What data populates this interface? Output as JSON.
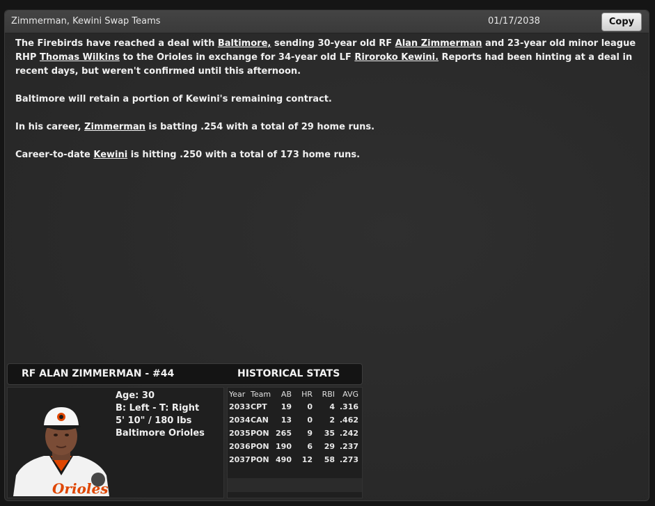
{
  "news": {
    "headline": "Zimmerman, Kewini Swap Teams",
    "date": "01/17/2038",
    "copy_label": "Copy",
    "p1": {
      "t1": "The Firebirds have reached a deal with ",
      "link_team": "Baltimore,",
      "t2": " sending 30-year old RF ",
      "link_player1": "Alan Zimmerman",
      "t3": " and 23-year old minor league RHP ",
      "link_player2": "Thomas Wilkins",
      "t4": " to the Orioles in exchange for 34-year old LF ",
      "link_player3": "Riroroko Kewini.",
      "t5": " Reports had been hinting at a deal in recent days, but weren't confirmed until this afternoon."
    },
    "p2": "Baltimore will retain a portion of Kewini's remaining contract.",
    "p3": {
      "t1": "In his career, ",
      "link": "Zimmerman",
      "t2": " is batting .254 with a total of 29 home runs."
    },
    "p4": {
      "t1": "Career-to-date ",
      "link": "Kewini",
      "t2": " is hitting .250 with a total of 173 home runs."
    }
  },
  "player": {
    "title": "RF ALAN ZIMMERMAN - #44",
    "age": "Age: 30",
    "bats_throws": "B: Left - T: Right",
    "size": "5' 10\" / 180 lbs",
    "team": "Baltimore Orioles",
    "jersey_text": "Orioles",
    "portrait_icon": "player-portrait-icon"
  },
  "stats": {
    "title": "HISTORICAL STATS",
    "headers": [
      "Year",
      "Team",
      "AB",
      "HR",
      "RBI",
      "AVG"
    ],
    "rows": [
      [
        "2033",
        "CPT",
        "19",
        "0",
        "4",
        ".316"
      ],
      [
        "2034",
        "CAN",
        "13",
        "0",
        "2",
        ".462"
      ],
      [
        "2035",
        "PON",
        "265",
        "9",
        "35",
        ".242"
      ],
      [
        "2036",
        "PON",
        "190",
        "6",
        "29",
        ".237"
      ],
      [
        "2037",
        "PON",
        "490",
        "12",
        "58",
        ".273"
      ]
    ]
  },
  "colors": {
    "background": "#2a2a2a",
    "header_bar": "#141414",
    "orioles_orange": "#df4601"
  }
}
